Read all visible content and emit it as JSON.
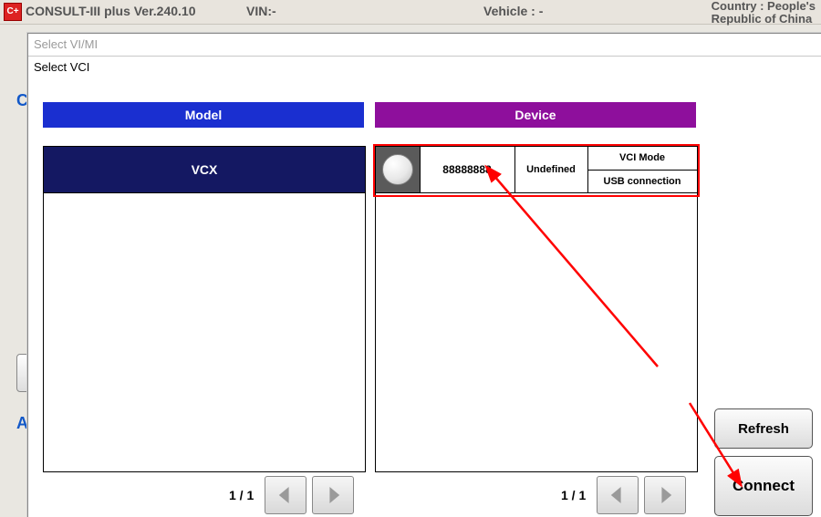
{
  "app": {
    "icon_text": "C+",
    "title": "CONSULT-III plus  Ver.240.10",
    "vin_label": "VIN:-",
    "vehicle_label": "Vehicle : -",
    "country_line1": "Country : People's",
    "country_line2": "Republic of China"
  },
  "sidebar_letters": {
    "c": "C",
    "a": "A"
  },
  "dialog": {
    "outer_title": "Select VI/MI",
    "inner_title": "Select VCI"
  },
  "panels": {
    "model": {
      "header": "Model",
      "item": "VCX",
      "page": "1 / 1"
    },
    "device": {
      "header": "Device",
      "serial": "88888888",
      "status": "Undefined",
      "mode": "VCI Mode",
      "connection": "USB connection",
      "page": "1 / 1"
    }
  },
  "buttons": {
    "refresh": "Refresh",
    "connect": "Connect"
  },
  "colors": {
    "model_header": "#1a2fd0",
    "device_header": "#8e0f9c",
    "model_strip": "#141862",
    "highlight": "#ff0000"
  }
}
